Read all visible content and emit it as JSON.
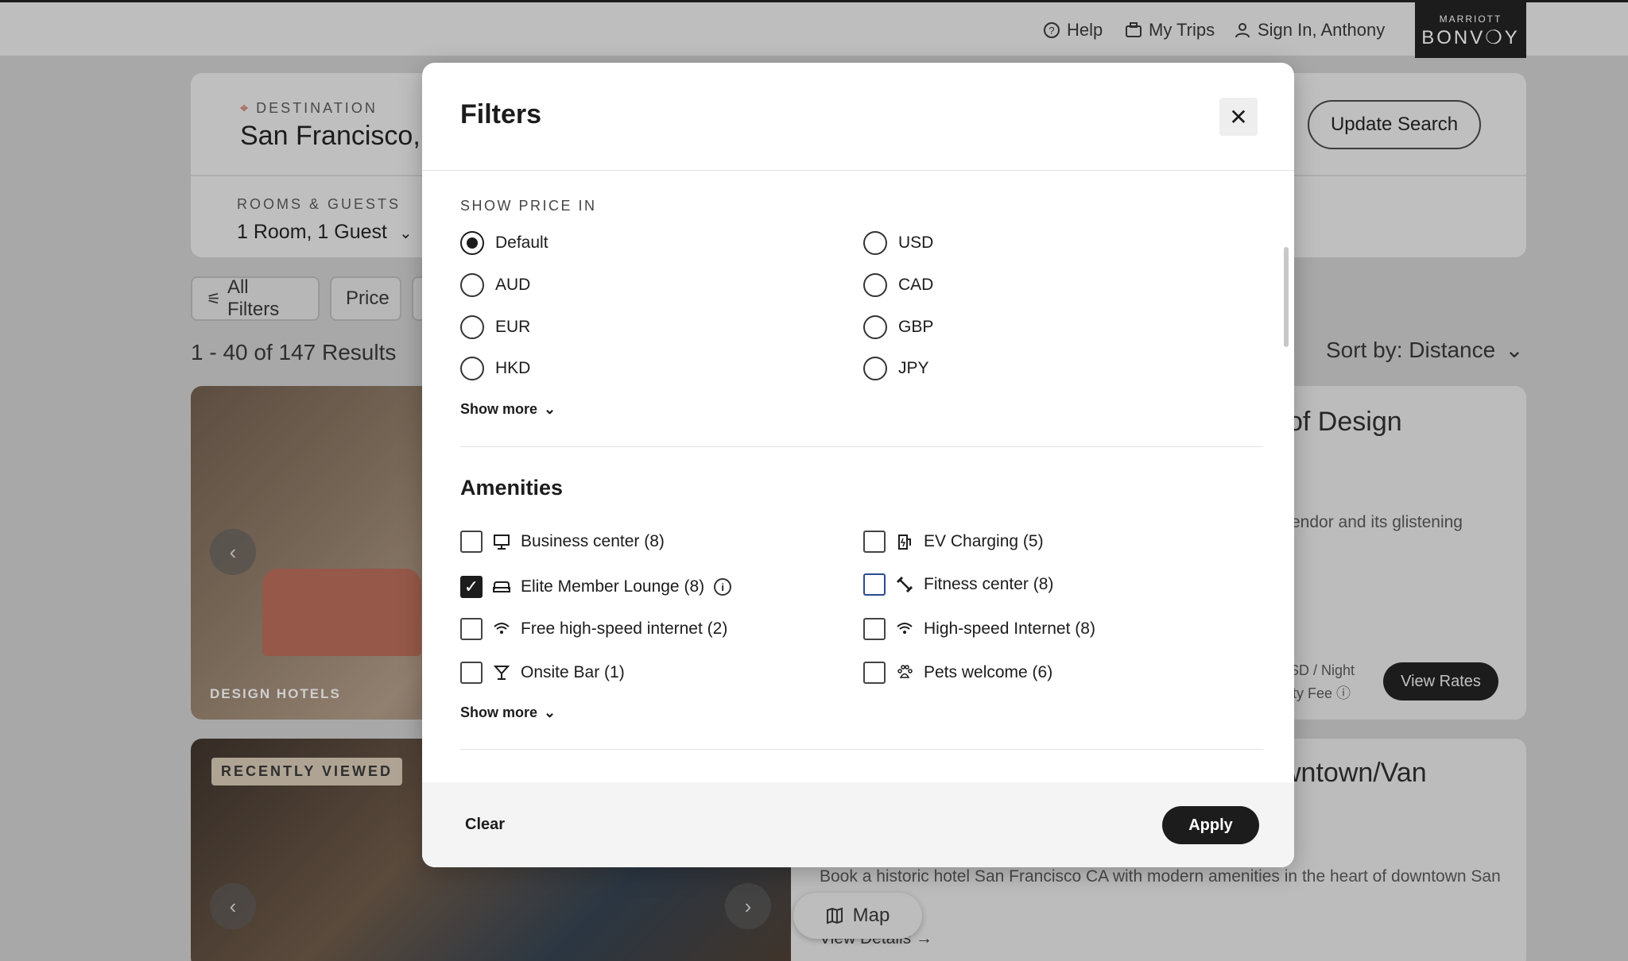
{
  "topnav": {
    "help": "Help",
    "trips": "My Trips",
    "signin": "Sign In, Anthony",
    "brand_top": "MARRIOTT",
    "brand_main": "BONV❍Y"
  },
  "search": {
    "dest_label": "DESTINATION",
    "dest_value": "San Francisco,",
    "rooms_label": "ROOMS & GUESTS",
    "rooms_value": "1 Room, 1 Guest",
    "update_button": "Update Search"
  },
  "filter_chips": {
    "all_filters": "All Filters",
    "price": "Price"
  },
  "results": {
    "count": "1 - 40 of 147 Results",
    "sort": "Sort by: Distance"
  },
  "cards": [
    {
      "badge": "DESIGN HOTELS",
      "title_fragment": "of Design",
      "desc_fragment": "endor and its glistening",
      "price_fragment": "SD / Night",
      "fee_fragment": "ity Fee",
      "cta": "View Rates"
    },
    {
      "badge": "RECENTLY VIEWED",
      "title_fragment": "wntown/Van",
      "desc": "Book a historic hotel San Francisco CA with modern amenities in the heart of downtown San",
      "link": "View Details"
    }
  ],
  "map_button": "Map",
  "modal": {
    "title": "Filters",
    "price_section_label": "SHOW PRICE IN",
    "currencies": [
      {
        "label": "Default",
        "checked": true
      },
      {
        "label": "USD",
        "checked": false
      },
      {
        "label": "AUD",
        "checked": false
      },
      {
        "label": "CAD",
        "checked": false
      },
      {
        "label": "EUR",
        "checked": false
      },
      {
        "label": "GBP",
        "checked": false
      },
      {
        "label": "HKD",
        "checked": false
      },
      {
        "label": "JPY",
        "checked": false
      }
    ],
    "show_more": "Show more",
    "amenities_heading": "Amenities",
    "amenities": [
      {
        "label": "Business center (8)",
        "icon": "monitor-icon",
        "checked": false
      },
      {
        "label": "EV Charging (5)",
        "icon": "ev-charging-icon",
        "checked": false
      },
      {
        "label": "Elite Member Lounge (8)",
        "icon": "lounge-icon",
        "checked": true
      },
      {
        "label": "Fitness center (8)",
        "icon": "dumbbell-icon",
        "checked": false
      },
      {
        "label": "Free high-speed internet (2)",
        "icon": "wifi-icon",
        "checked": false
      },
      {
        "label": "High-speed Internet (8)",
        "icon": "wifi-icon",
        "checked": false
      },
      {
        "label": "Onsite Bar (1)",
        "icon": "cocktail-icon",
        "checked": false
      },
      {
        "label": "Pets welcome (6)",
        "icon": "paw-icon",
        "checked": false
      }
    ],
    "clear": "Clear",
    "apply": "Apply"
  }
}
